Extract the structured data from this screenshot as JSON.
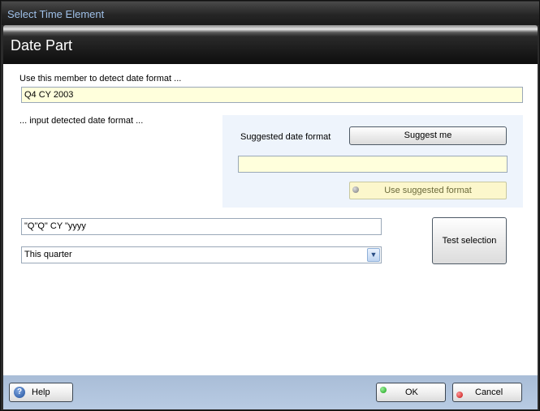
{
  "window": {
    "title": "Select Time Element"
  },
  "header": {
    "title": "Date Part"
  },
  "detect": {
    "label": "Use this member to detect date format ...",
    "member_value": "Q4 CY 2003"
  },
  "input_format": {
    "label": "... input detected date format ..."
  },
  "suggest_panel": {
    "label": "Suggested date format",
    "suggest_button": "Suggest me",
    "suggested_value": "",
    "use_button": "Use suggested format"
  },
  "format_field": {
    "value": "\"Q\"Q\" CY \"yyyy"
  },
  "period_select": {
    "selected": "This quarter"
  },
  "test_button": "Test selection",
  "footer": {
    "help_label": "Help",
    "ok_label": "OK",
    "cancel_label": "Cancel"
  },
  "colors": {
    "title_text": "#9fc0e8",
    "input_yellow": "#ffffdc",
    "panel_bg": "#eef4fc",
    "footer_bg": "#b0c4dd",
    "ok_indicator": "#22b322",
    "cancel_indicator": "#d41a1a"
  }
}
